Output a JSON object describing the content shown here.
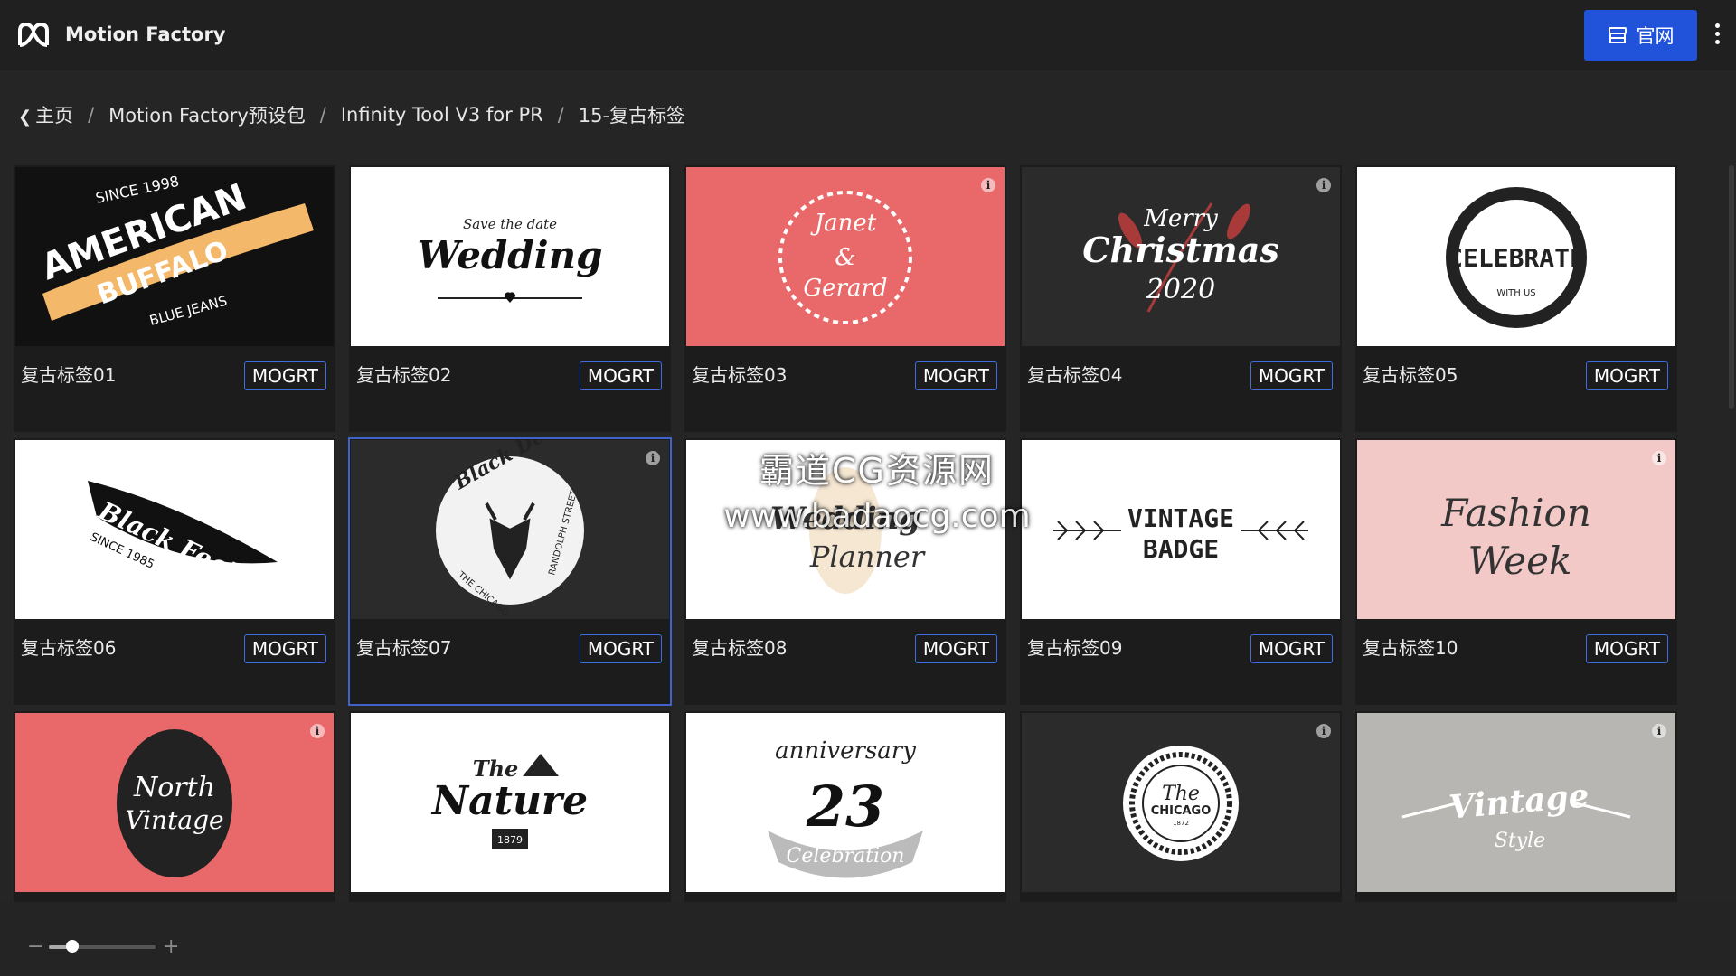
{
  "app": {
    "title": "Motion Factory"
  },
  "header": {
    "site_button_label": "官网"
  },
  "breadcrumb": [
    {
      "label": "主页"
    },
    {
      "label": "Motion Factory预设包"
    },
    {
      "label": "Infinity Tool V3 for PR"
    },
    {
      "label": "15-复古标签"
    }
  ],
  "colors": {
    "accent": "#2053d9",
    "mogrt_border": "#3f6ee0",
    "selected_outline": "#3f63c8"
  },
  "items": [
    {
      "name": "复古标签01",
      "button": "MOGRT",
      "thumb_bg": "#111111",
      "thumb_text": [
        "SINCE 1998",
        "AMERICAN",
        "BUFFALO",
        "BLUE JEANS"
      ]
    },
    {
      "name": "复古标签02",
      "button": "MOGRT",
      "thumb_bg": "#ffffff",
      "thumb_text": [
        "Save the date",
        "Wedding"
      ]
    },
    {
      "name": "复古标签03",
      "button": "MOGRT",
      "thumb_bg": "#e9696a",
      "thumb_text": [
        "Janet",
        "&",
        "Gerard"
      ]
    },
    {
      "name": "复古标签04",
      "button": "MOGRT",
      "thumb_bg": "#2b2b2b",
      "thumb_text": [
        "Merry",
        "Christmas",
        "2020"
      ]
    },
    {
      "name": "复古标签05",
      "button": "MOGRT",
      "thumb_bg": "#ffffff",
      "thumb_text": [
        "CELEBRATE",
        "WITH US"
      ]
    },
    {
      "name": "复古标签06",
      "button": "MOGRT",
      "thumb_bg": "#ffffff",
      "thumb_text": [
        "Black Feather",
        "SINCE 1985"
      ]
    },
    {
      "name": "复古标签07",
      "button": "MOGRT",
      "thumb_bg": "#2b2b2b",
      "thumb_text": [
        "Black Deer",
        "THE CHICAGO",
        "RANDOLPH STREET"
      ]
    },
    {
      "name": "复古标签08",
      "button": "MOGRT",
      "thumb_bg": "#ffffff",
      "thumb_text": [
        "Wedding",
        "Planner"
      ]
    },
    {
      "name": "复古标签09",
      "button": "MOGRT",
      "thumb_bg": "#ffffff",
      "thumb_text": [
        "VINTAGE",
        "BADGE"
      ]
    },
    {
      "name": "复古标签10",
      "button": "MOGRT",
      "thumb_bg": "#f2c9c7",
      "thumb_text": [
        "Fashion",
        "Week"
      ]
    },
    {
      "name": "",
      "button": "",
      "thumb_bg": "#e9696a",
      "thumb_text": [
        "North",
        "Vintage"
      ]
    },
    {
      "name": "",
      "button": "",
      "thumb_bg": "#ffffff",
      "thumb_text": [
        "The",
        "Nature",
        "1879"
      ]
    },
    {
      "name": "",
      "button": "",
      "thumb_bg": "#ffffff",
      "thumb_text": [
        "anniversary",
        "23",
        "Celebration"
      ]
    },
    {
      "name": "",
      "button": "",
      "thumb_bg": "#2b2b2b",
      "thumb_text": [
        "The",
        "CHICAGO",
        "1872"
      ]
    },
    {
      "name": "",
      "button": "",
      "thumb_bg": "#b7b6b3",
      "thumb_text": [
        "Vintage",
        "Style"
      ]
    }
  ],
  "watermark": {
    "line1": "霸道CG资源网",
    "line2": "www.badaocg.com"
  },
  "zoom": {
    "minus": "−",
    "plus": "+",
    "level": 0.22
  }
}
